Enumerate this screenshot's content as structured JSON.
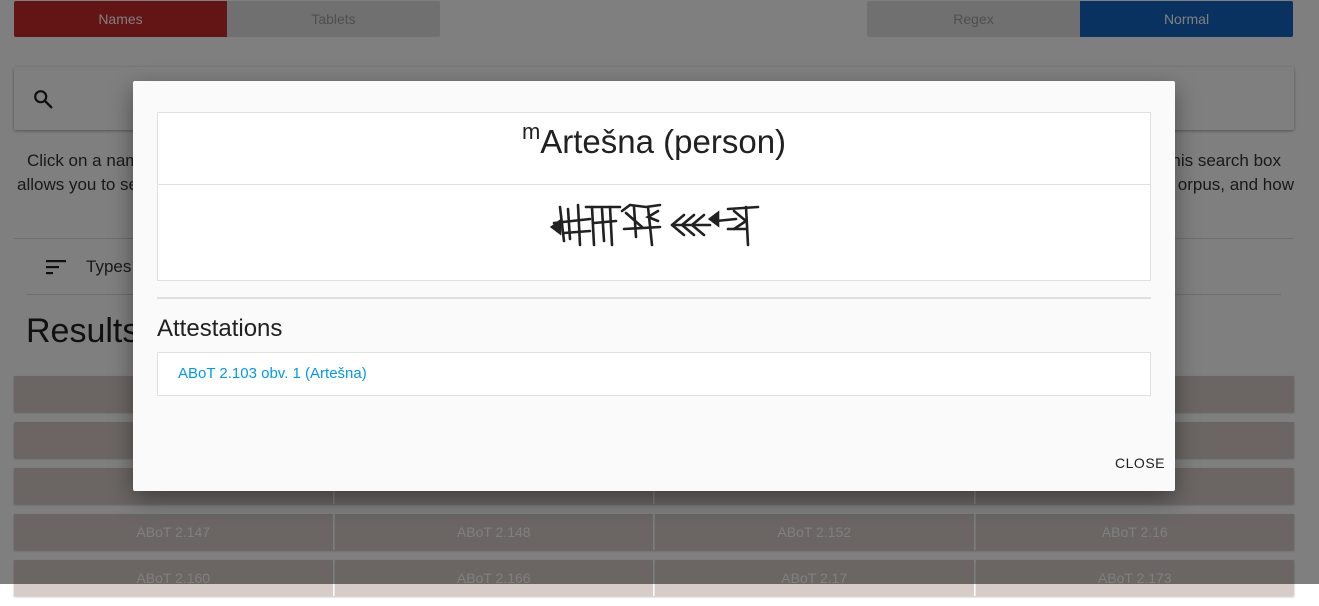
{
  "mode_toggle": {
    "names": "Names",
    "tablets": "Tablets"
  },
  "search_type_toggle": {
    "regex": "Regex",
    "normal": "Normal"
  },
  "colors": {
    "active_red": "#c62828",
    "active_blue": "#1565c0",
    "inactive_gray": "#e0e0e0",
    "result_cell": "#d7ccc8",
    "link_blue": "#039be5"
  },
  "search": {
    "icon": "search-icon"
  },
  "help": {
    "line1_left": "Click on a nam",
    "line1_right": "his search box",
    "line2_left": "allows you to se",
    "line2_right": "orpus, and how"
  },
  "filters": {
    "types_label": "Types",
    "icon": "sort-icon"
  },
  "results": {
    "title": "Results",
    "rows": [
      [
        "",
        "",
        "",
        ""
      ],
      [
        "",
        "",
        "",
        ""
      ],
      [
        "",
        "",
        "",
        ""
      ],
      [
        "ABoT 2.147",
        "ABoT 2.148",
        "ABoT 2.152",
        "ABoT 2.16"
      ],
      [
        "ABoT 2.160",
        "ABoT 2.166",
        "ABoT 2.17",
        "ABoT 2.173"
      ]
    ]
  },
  "modal": {
    "title_prefix": "m",
    "title": "Artešna (person)",
    "cuneiform_icon": "cuneiform-sign-image",
    "attestations_title": "Attestations",
    "attestations": [
      "ABoT 2.103 obv. 1 (Artešna)"
    ],
    "close_label": "CLOSE"
  }
}
